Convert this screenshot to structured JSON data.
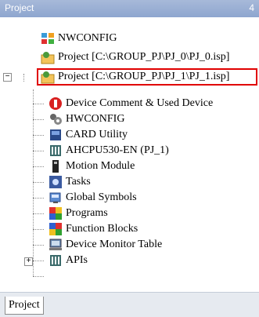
{
  "panel": {
    "title": "Project",
    "pin": "4"
  },
  "tree": {
    "items": [
      {
        "label": "NWCONFIG",
        "icon": "network-config-icon"
      },
      {
        "label": "Project [C:\\GROUP_PJ\\PJ_0\\PJ_0.isp]",
        "icon": "project-icon"
      },
      {
        "label": "Project [C:\\GROUP_PJ\\PJ_1\\PJ_1.isp]",
        "icon": "project-icon",
        "expander": "−"
      },
      {
        "label": "Device Comment & Used Device",
        "icon": "device-comment-icon"
      },
      {
        "label": "HWCONFIG",
        "icon": "hardware-config-icon"
      },
      {
        "label": "CARD Utility",
        "icon": "card-utility-icon"
      },
      {
        "label": "AHCPU530-EN  (PJ_1)",
        "icon": "cpu-module-icon"
      },
      {
        "label": "Motion Module",
        "icon": "motion-module-icon"
      },
      {
        "label": "Tasks",
        "icon": "tasks-icon"
      },
      {
        "label": "Global Symbols",
        "icon": "global-symbols-icon"
      },
      {
        "label": "Programs",
        "icon": "programs-icon"
      },
      {
        "label": "Function Blocks",
        "icon": "function-blocks-icon"
      },
      {
        "label": "Device Monitor Table",
        "icon": "device-monitor-icon"
      },
      {
        "label": "APIs",
        "icon": "apis-icon",
        "expander": "+"
      }
    ]
  },
  "bottom_tab": {
    "label": "Project"
  },
  "colors": {
    "highlight_border": "#e00000",
    "title_bar": "#9bb0d5"
  }
}
